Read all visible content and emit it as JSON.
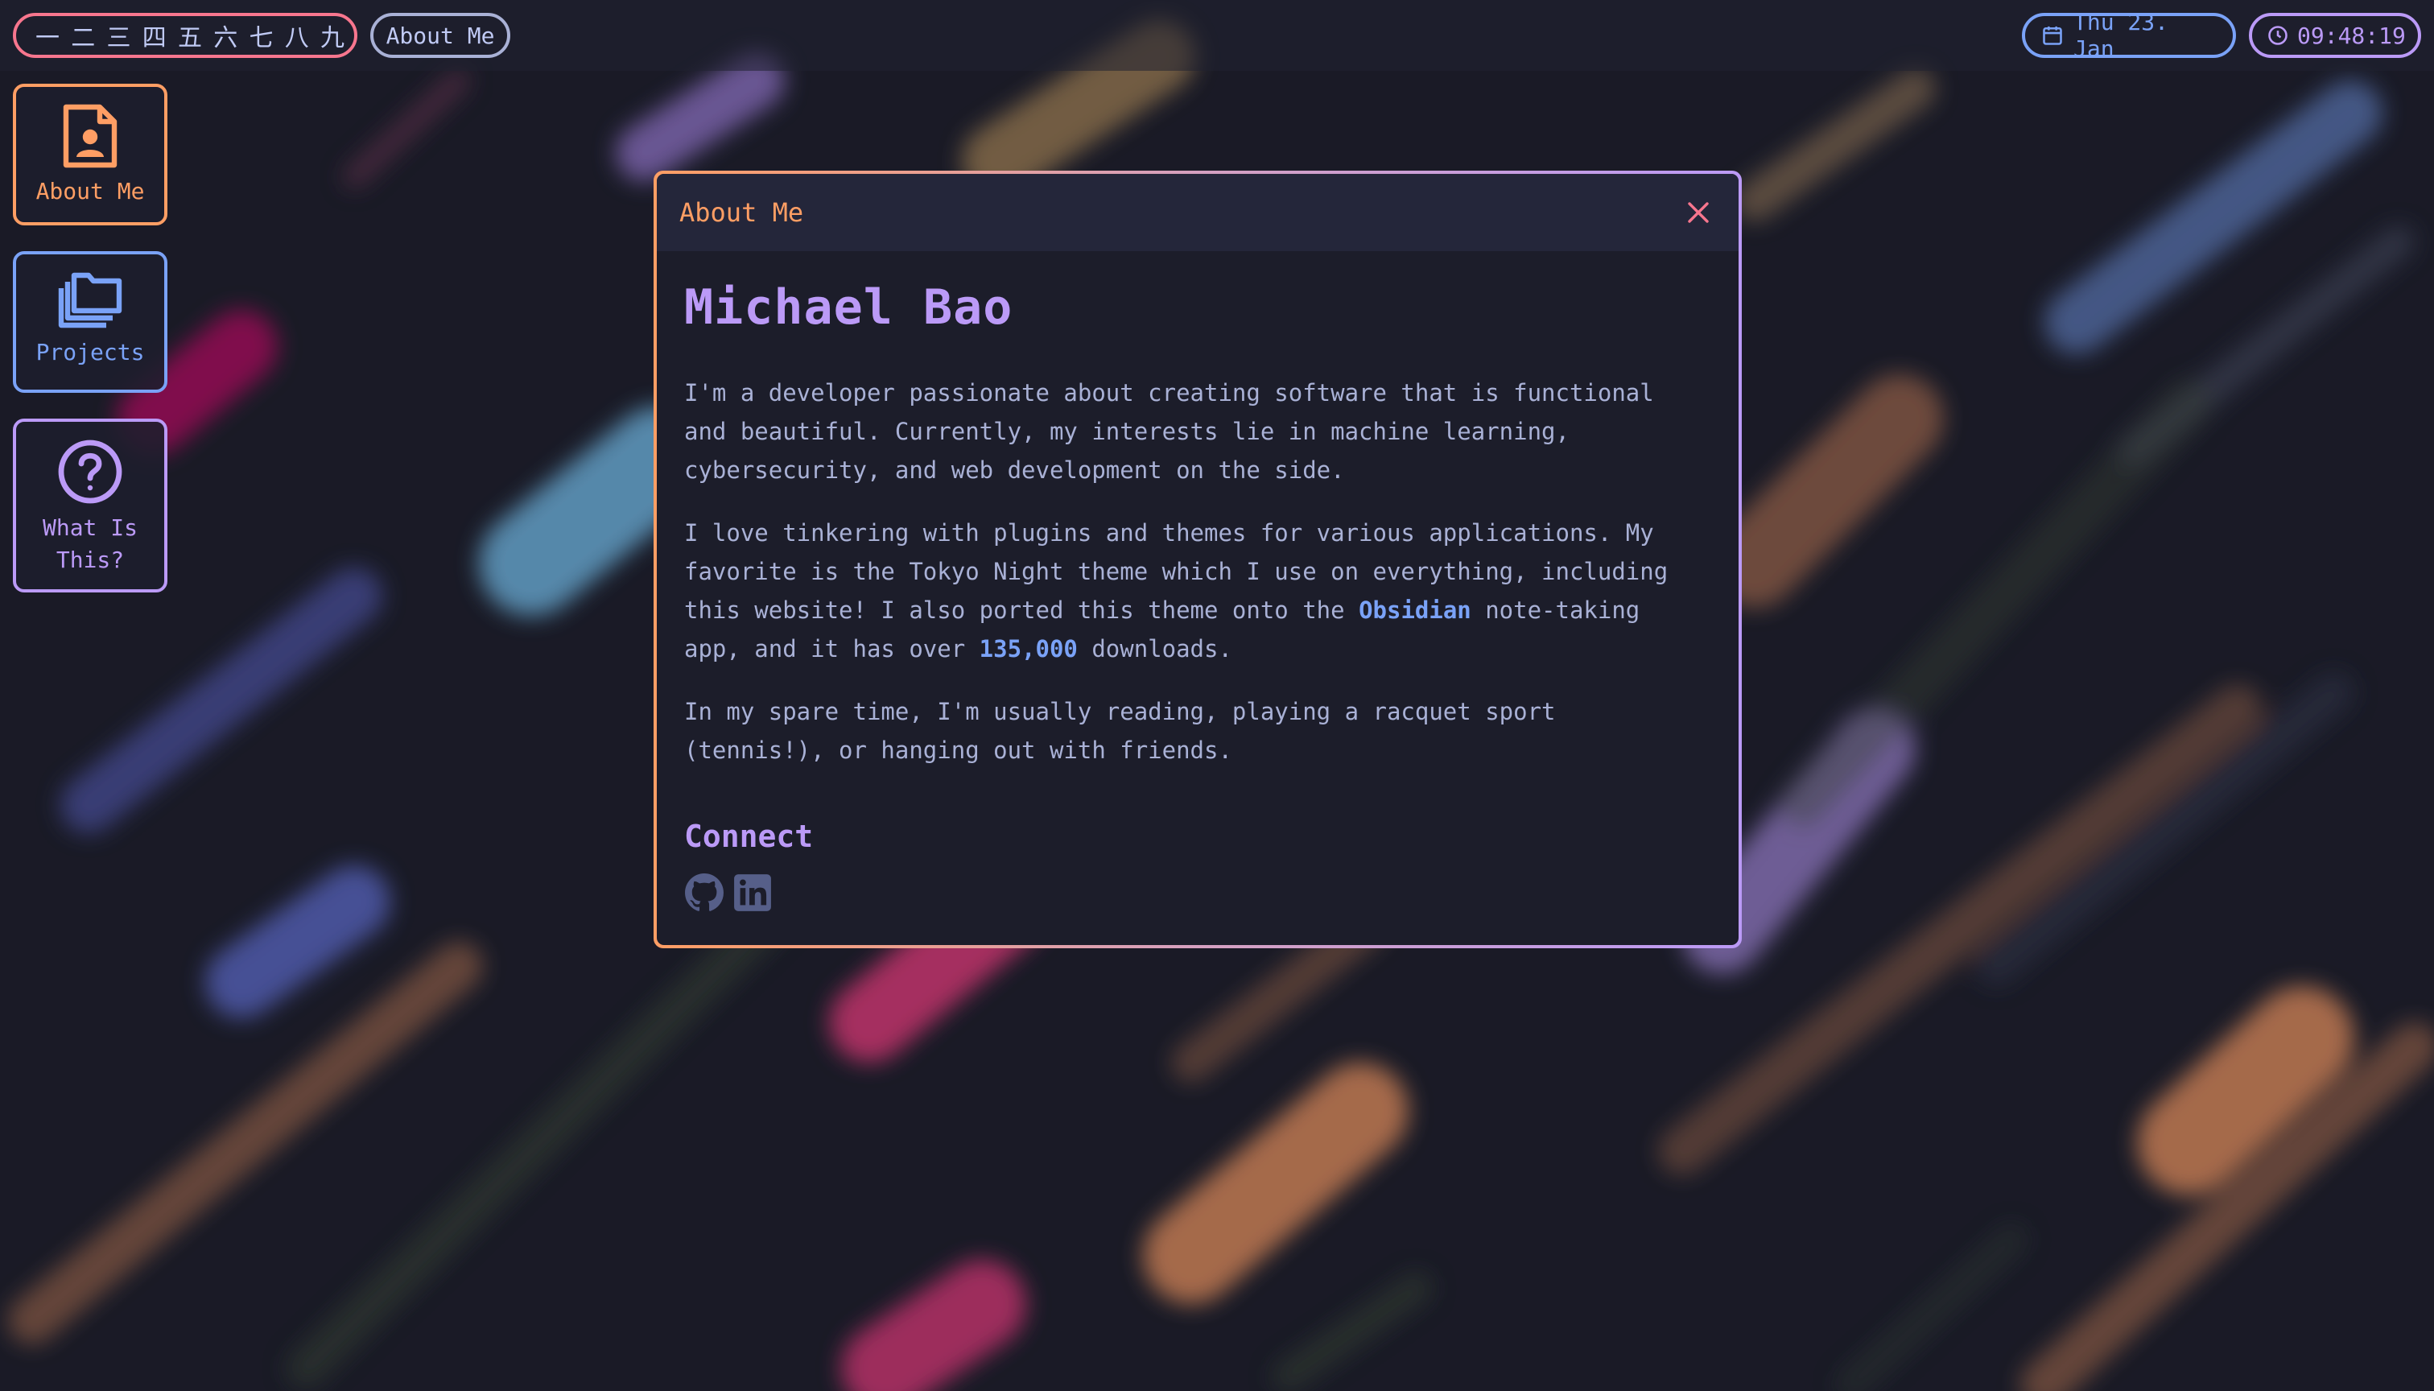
{
  "topbar": {
    "workspaces": [
      "一",
      "二",
      "三",
      "四",
      "五",
      "六",
      "七",
      "八",
      "九"
    ],
    "active_window": "About Me",
    "date": "Thu 23. Jan",
    "time": "09:48:19"
  },
  "icons": {
    "calendar": "calendar-icon",
    "clock": "clock-icon",
    "close": "close-icon",
    "person_doc": "person-document-icon",
    "folders": "folders-icon",
    "question": "question-circle-icon",
    "github": "github-icon",
    "linkedin": "linkedin-icon"
  },
  "desktop": [
    {
      "label": "About Me",
      "icon": "person-document-icon"
    },
    {
      "label": "Projects",
      "icon": "folders-icon"
    },
    {
      "label": "What Is This?",
      "label_lines": [
        "What Is",
        "This?"
      ],
      "icon": "question-circle-icon"
    }
  ],
  "window": {
    "title": "About Me",
    "name": "Michael Bao",
    "p1": "I'm a developer passionate about creating software that is functional and beautiful. Currently, my interests lie in machine learning, cybersecurity, and web development on the side.",
    "p2_a": "I love tinkering with plugins and themes for various applications. My favorite is the Tokyo Night theme which I use on everything, including this website! I also ported this theme onto the ",
    "p2_link": "Obsidian",
    "p2_b": " note-taking app, and it has over ",
    "p2_count": "135,000",
    "p2_c": " downloads.",
    "p3": "In my spare time, I'm usually reading, playing a racquet sport (tennis!), or hanging out with friends.",
    "connect": "Connect",
    "socials": [
      "github-icon",
      "linkedin-icon"
    ]
  },
  "colors": {
    "background": "#1b1c28",
    "red": "#f7768e",
    "orange": "#ff9e64",
    "blue": "#7aa2f7",
    "purple": "#bb9af7",
    "text": "#a9b1d6",
    "icon_gray": "#565f89"
  }
}
